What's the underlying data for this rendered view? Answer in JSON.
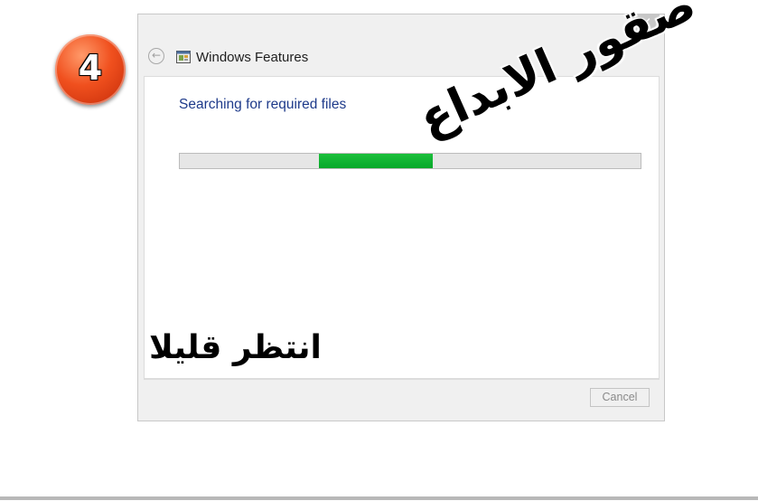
{
  "step": {
    "number": "4"
  },
  "dialog": {
    "title": "Windows Features",
    "heading": "Searching for required files",
    "progress_fraction": 0.25,
    "cancel_label": "Cancel",
    "close_glyph": "✕",
    "back_glyph": "←"
  },
  "watermark": {
    "primary": "صقور الابداع",
    "secondary": "انتظر قليلا"
  },
  "colors": {
    "accent_text": "#1e3a8a",
    "progress_green": "#0fb334",
    "badge_orange": "#f0501e"
  },
  "icons": [
    "back-arrow-icon",
    "windows-features-icon",
    "close-icon"
  ]
}
